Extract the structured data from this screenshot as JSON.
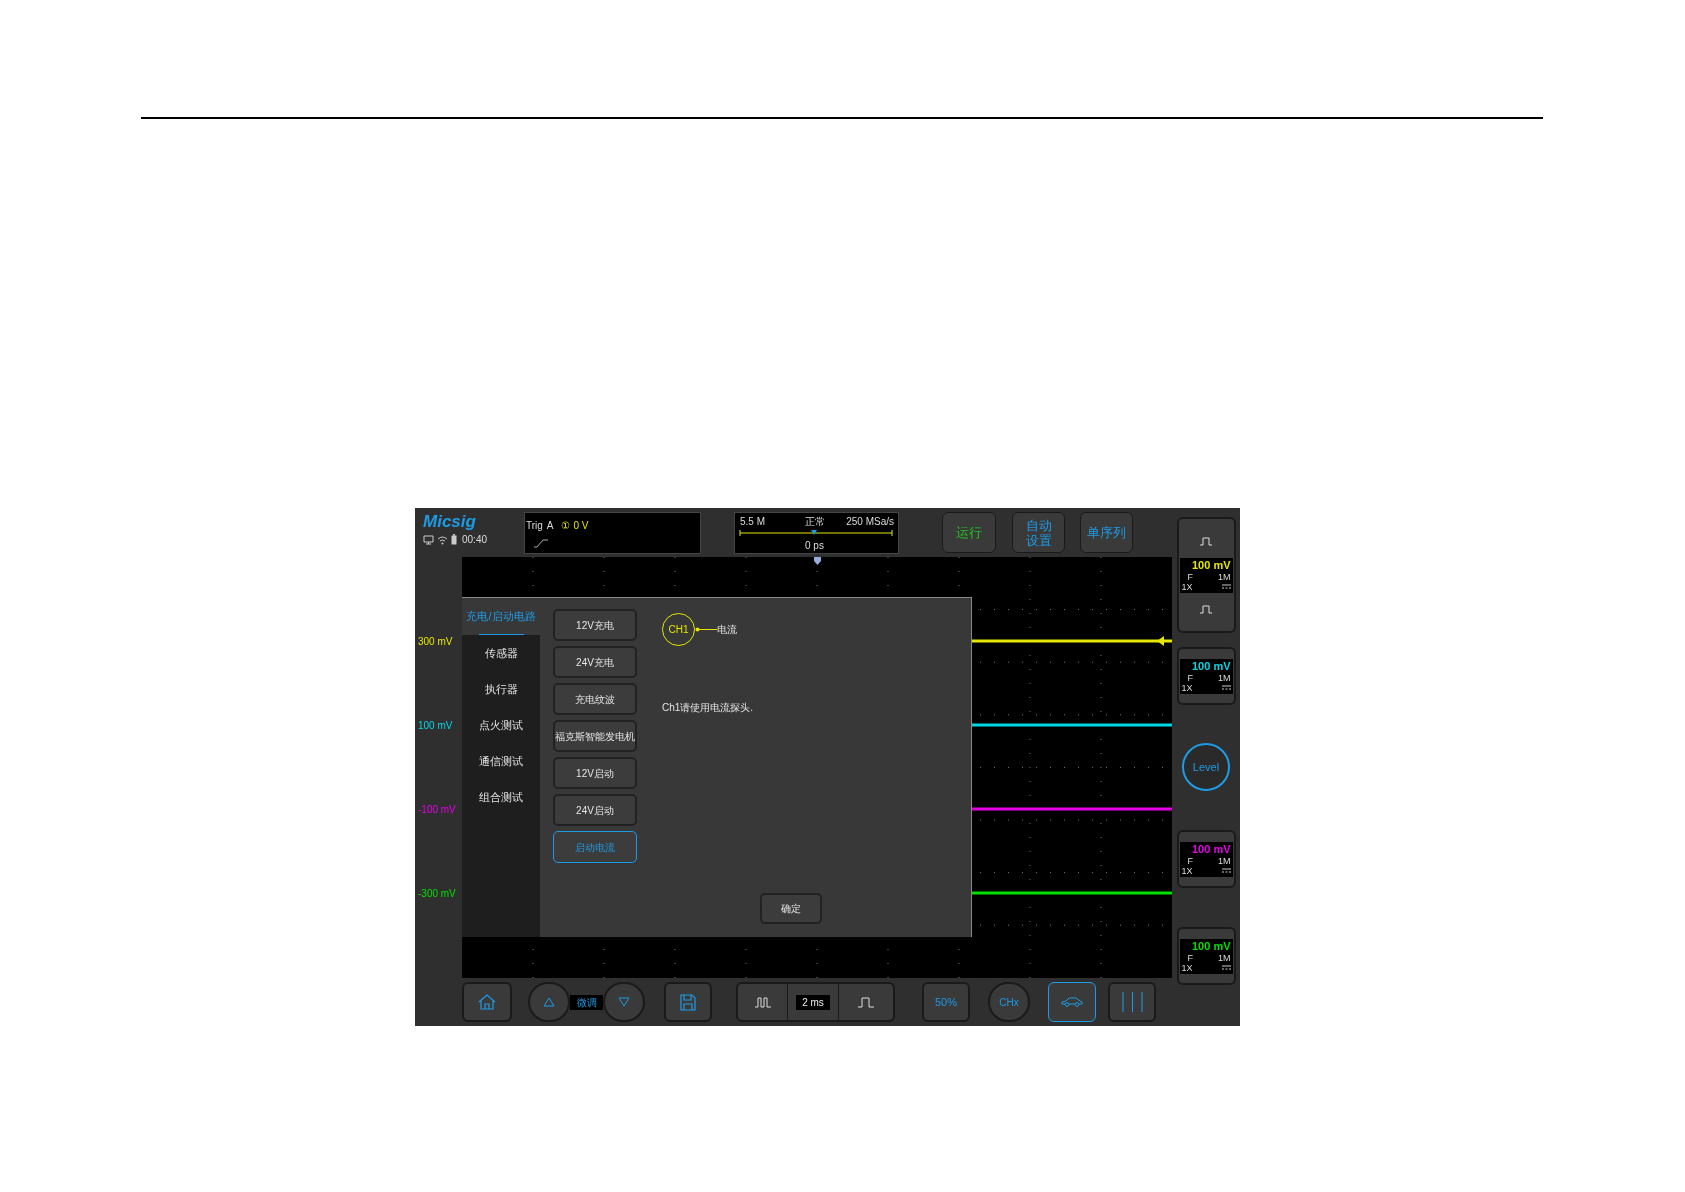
{
  "header": {
    "logo": "Micsig",
    "time": "00:40"
  },
  "trigger": {
    "label": "Trig",
    "source": "A",
    "channel_mark": "①",
    "level": "0 V"
  },
  "timebase": {
    "memory": "5.5 M",
    "mode": "正常",
    "sample_rate": "250 MSa/s",
    "position": "0 ps"
  },
  "top_buttons": [
    {
      "label": "运行",
      "color": "#22c322"
    },
    {
      "label": "自动设置",
      "color": "#1e9be6"
    },
    {
      "label": "单序列",
      "color": "#1e9be6"
    }
  ],
  "channels": [
    {
      "offset_label": "300 mV",
      "scale": "100 mV",
      "coupling": "F",
      "impedance": "1M",
      "probe": "1X",
      "color": "#e6e600"
    },
    {
      "offset_label": "100 mV",
      "scale": "100 mV",
      "coupling": "F",
      "impedance": "1M",
      "probe": "1X",
      "color": "#00d8e6"
    },
    {
      "offset_label": "-100 mV",
      "scale": "100 mV",
      "coupling": "F",
      "impedance": "1M",
      "probe": "1X",
      "color": "#e600e6"
    },
    {
      "offset_label": "-300 mV",
      "scale": "100 mV",
      "coupling": "F",
      "impedance": "1M",
      "probe": "1X",
      "color": "#00e000"
    }
  ],
  "level_button": "Level",
  "dialog": {
    "menu": [
      {
        "label": "充电/启动电路",
        "selected": true
      },
      {
        "label": "传感器",
        "selected": false
      },
      {
        "label": "执行器",
        "selected": false
      },
      {
        "label": "点火测试",
        "selected": false
      },
      {
        "label": "通信测试",
        "selected": false
      },
      {
        "label": "组合测试",
        "selected": false
      }
    ],
    "tests": [
      {
        "label": "12V充电",
        "selected": false
      },
      {
        "label": "24V充电",
        "selected": false
      },
      {
        "label": "充电纹波",
        "selected": false
      },
      {
        "label": "福克斯智能发电机",
        "selected": false
      },
      {
        "label": "12V启动",
        "selected": false
      },
      {
        "label": "24V启动",
        "selected": false
      },
      {
        "label": "启动电流",
        "selected": true
      }
    ],
    "probe_channel": "CH1",
    "probe_label": "电流",
    "instruction": "Ch1请使用电流探头.",
    "confirm": "确定"
  },
  "bottom": {
    "fine_tune": "微调",
    "timebase": "2 ms",
    "trigger_percent": "50%",
    "channel_select": "CHx",
    "tools": [
      {
        "kind": "car",
        "selected": true
      },
      {
        "kind": "cursors",
        "selected": false
      }
    ]
  }
}
